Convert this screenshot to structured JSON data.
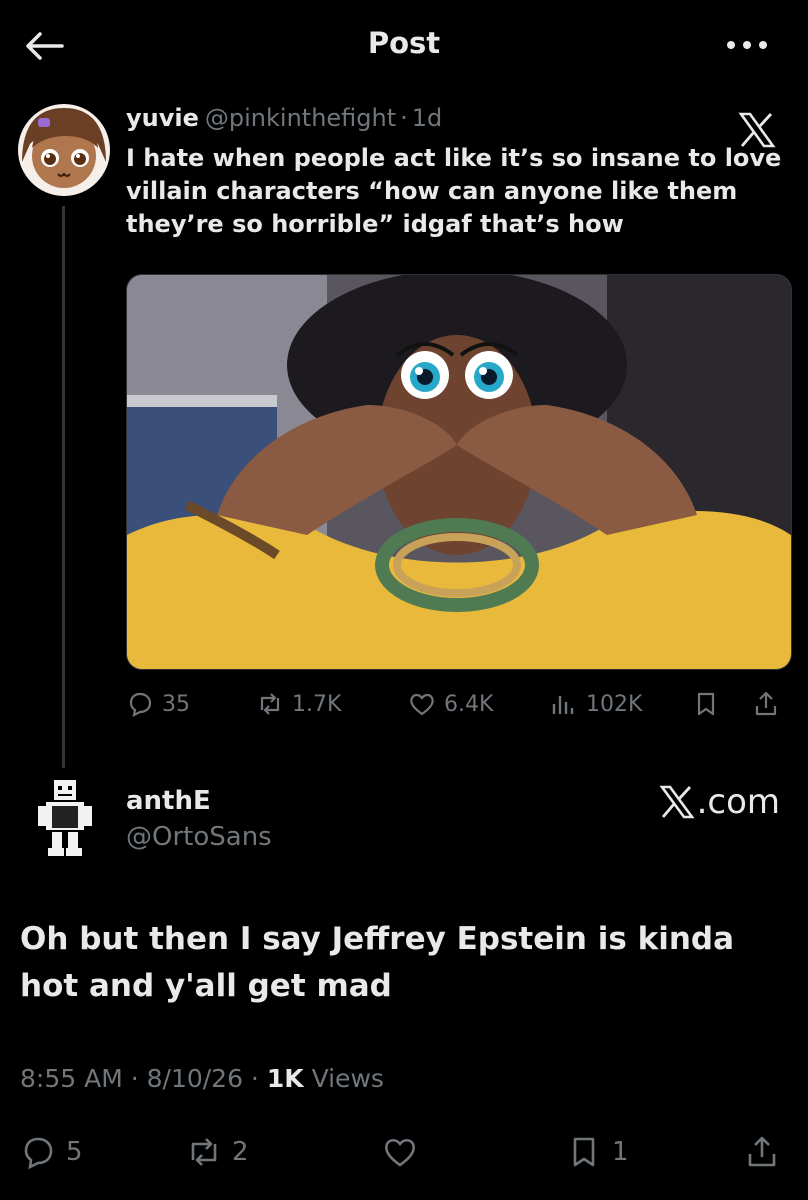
{
  "header": {
    "title": "Post",
    "back_icon": "back-arrow-icon",
    "more_icon": "more-dots-icon"
  },
  "quoted": {
    "name": "yuvie",
    "handle": "@pinkinthefight",
    "separator": "·",
    "time": "1d",
    "text": "I hate when people act like it’s so insane to love villain characters “how can anyone like them they’re so horrible” idgaf that’s how",
    "media_icon": "reaction-photo",
    "actions": {
      "replies": "35",
      "reposts": "1.7K",
      "likes": "6.4K",
      "views": "102K"
    }
  },
  "reply": {
    "name": "anthE",
    "handle": "@OrtoSans",
    "brand": ".com",
    "text": "Oh but then I say Jeffrey Epstein is kinda hot and y'all get mad",
    "meta": {
      "time": "8:55 AM",
      "date": "8/10/26",
      "views_count": "1K",
      "views_label": "Views",
      "sep": " · "
    },
    "actions": {
      "replies": "5",
      "reposts": "2",
      "bookmarks": "1"
    }
  },
  "colors": {
    "background": "#000000",
    "text": "#e7e9ea",
    "muted": "#71767b"
  }
}
